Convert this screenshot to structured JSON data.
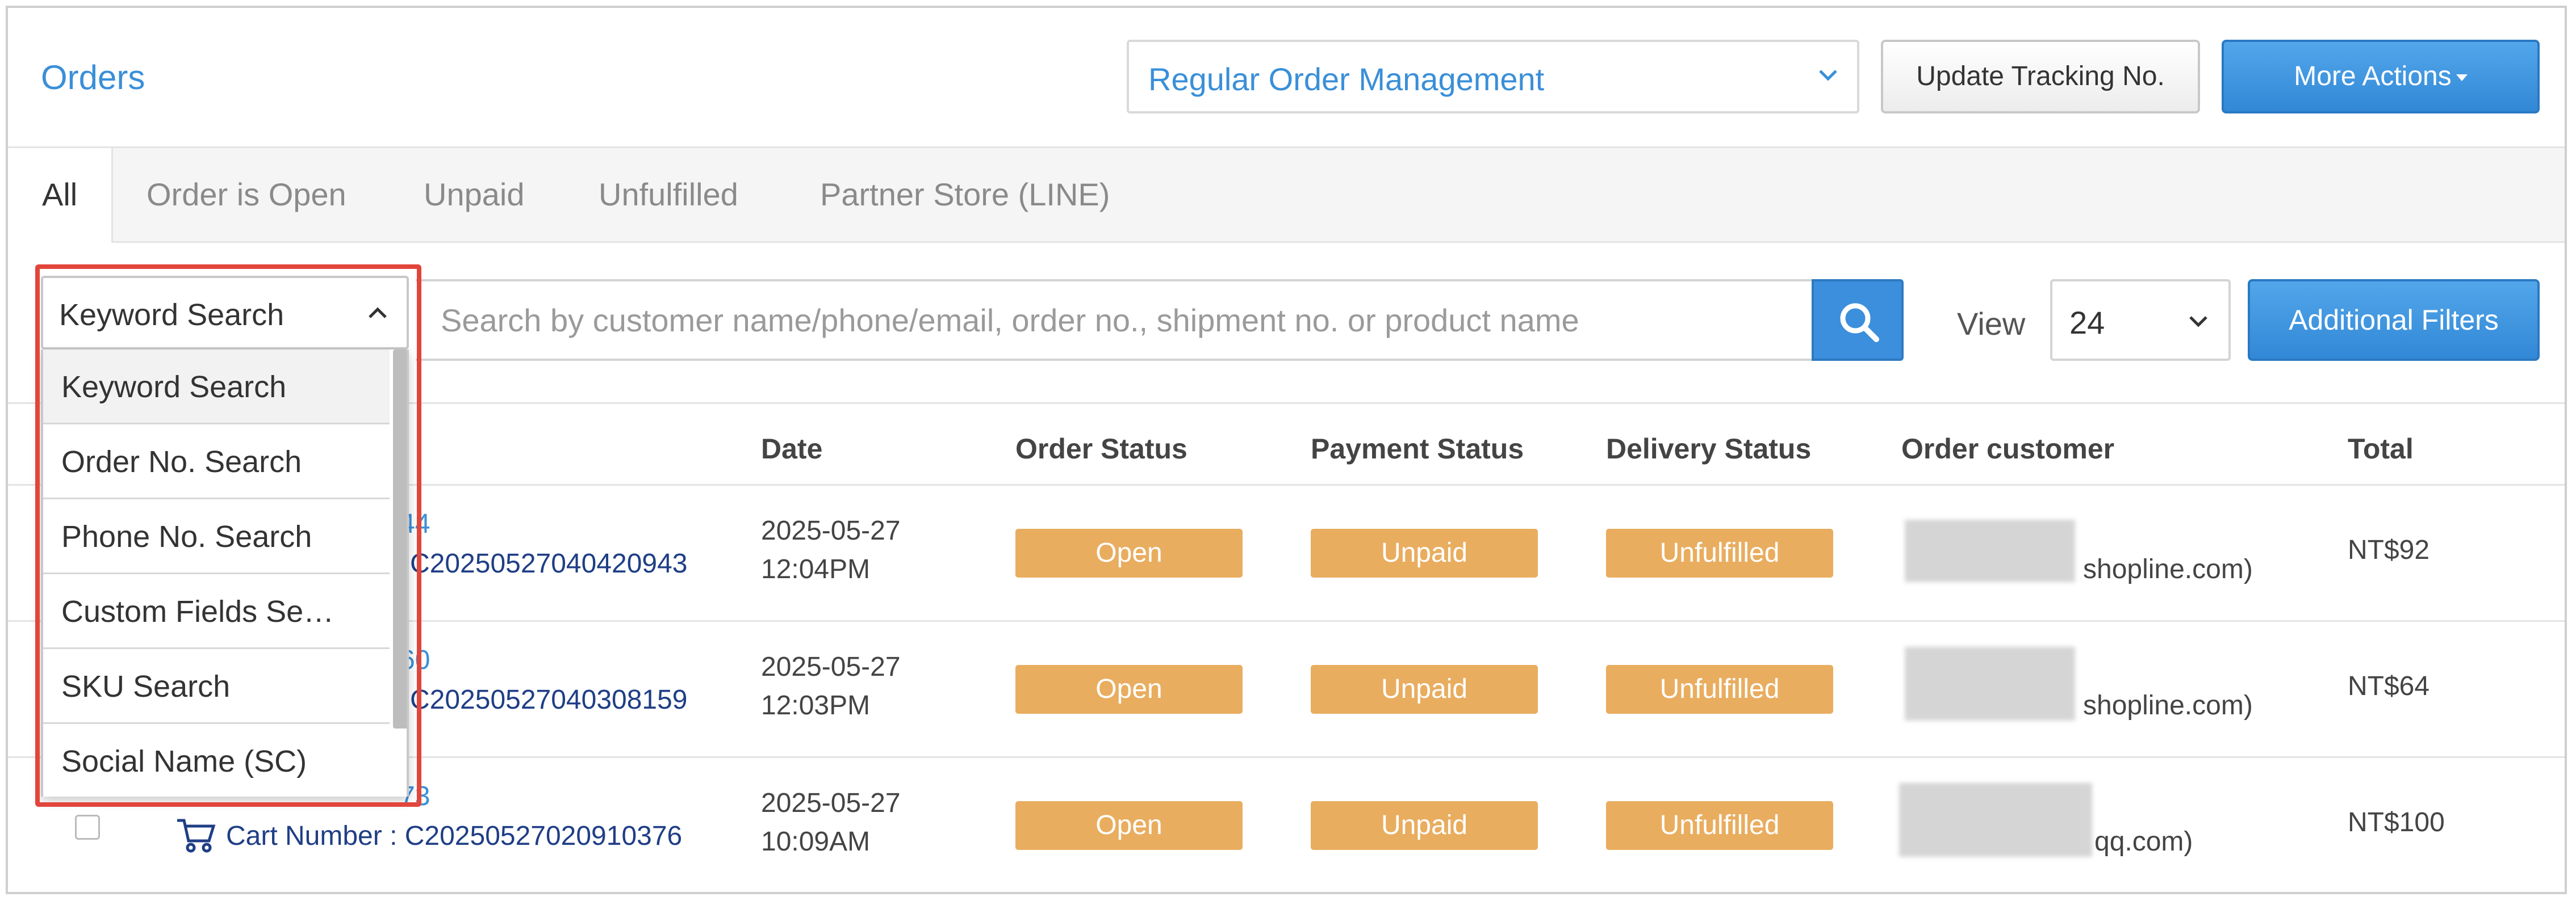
{
  "header": {
    "title": "Orders",
    "management_select": "Regular Order Management",
    "update_tracking_label": "Update Tracking No.",
    "more_actions_label": "More Actions"
  },
  "tabs": [
    {
      "label": "All",
      "active": true
    },
    {
      "label": "Order is Open"
    },
    {
      "label": "Unpaid"
    },
    {
      "label": "Unfulfilled"
    },
    {
      "label": "Partner Store (LINE)"
    }
  ],
  "filter": {
    "search_type_selected": "Keyword Search",
    "search_placeholder": "Search by customer name/phone/email, order no., shipment no. or product name",
    "view_label": "View",
    "view_value": "24",
    "additional_filters_label": "Additional Filters"
  },
  "dropdown": {
    "options": [
      "Keyword Search",
      "Order No. Search",
      "Phone No. Search",
      "Custom Fields Se…",
      "SKU Search",
      "Social Name (SC)"
    ]
  },
  "table": {
    "columns": [
      "Date",
      "Order Status",
      "Payment Status",
      "Delivery Status",
      "Order customer",
      "Total"
    ],
    "rows": [
      {
        "order_no_fragment": "44",
        "cart_fragment": "C20250527040420943",
        "date": "2025-05-27",
        "time": "12:04PM",
        "order_status": "Open",
        "payment_status": "Unpaid",
        "delivery_status": "Unfulfilled",
        "customer_suffix": "shopline.com)",
        "total": "NT$92"
      },
      {
        "order_no_fragment": "60",
        "cart_fragment": "C20250527040308159",
        "date": "2025-05-27",
        "time": "12:03PM",
        "order_status": "Open",
        "payment_status": "Unpaid",
        "delivery_status": "Unfulfilled",
        "customer_suffix": "shopline.com)",
        "total": "NT$64"
      },
      {
        "order_no_fragment": "73",
        "cart_label": "Cart Number : C20250527020910376",
        "date": "2025-05-27",
        "time": "10:09AM",
        "order_status": "Open",
        "payment_status": "Unpaid",
        "delivery_status": "Unfulfilled",
        "customer_suffix": "qq.com)",
        "total": "NT$100"
      }
    ]
  },
  "colors": {
    "accent": "#3a8fd8",
    "primary_button": "#3b8fdc",
    "status_badge": "#e9ad5f",
    "highlight": "#e2453b"
  }
}
